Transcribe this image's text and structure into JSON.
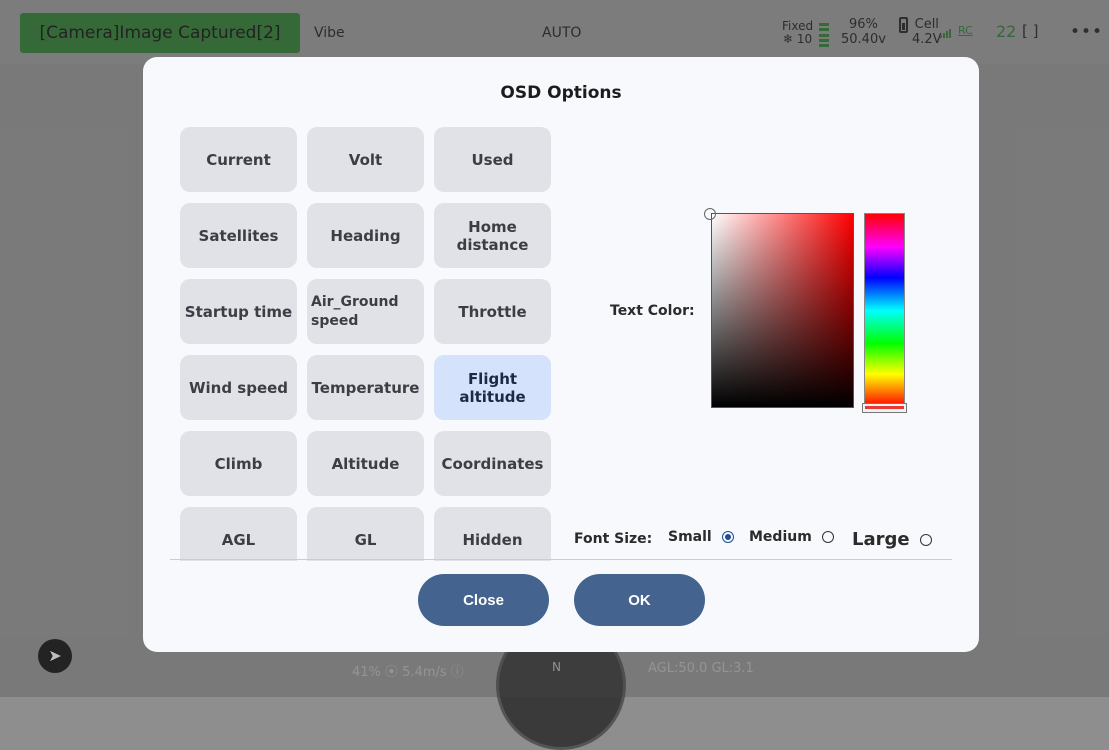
{
  "topbar": {
    "camera_status": "[Camera]Image Captured[2]",
    "vibe": "Vibe",
    "flight_mode": "AUTO",
    "gps_fix": "Fixed",
    "gps_sats": "❄ 10",
    "battery_percent": "96%",
    "battery_voltage": "50.40v",
    "cell_label": "Cell",
    "cell_voltage": "4.2V",
    "rc_label": "RC",
    "rc_value": "22",
    "brackets": "[ ]",
    "more": "•••"
  },
  "background": {
    "bottom_left_stat": "41% ⦿ 5.4m/s ⓘ",
    "bottom_right_stat": "AGL:50.0 GL:3.1",
    "compass_north": "N"
  },
  "dialog": {
    "title": "OSD Options",
    "options": [
      {
        "label": "Current",
        "selected": false
      },
      {
        "label": "Volt",
        "selected": false
      },
      {
        "label": "Used",
        "selected": false
      },
      {
        "label": "Satellites",
        "selected": false
      },
      {
        "label": "Heading",
        "selected": false
      },
      {
        "label": "Home distance",
        "selected": false
      },
      {
        "label": "Startup time",
        "selected": false
      },
      {
        "label": "Air_Ground speed",
        "selected": false
      },
      {
        "label": "Throttle",
        "selected": false
      },
      {
        "label": "Wind speed",
        "selected": false
      },
      {
        "label": "Temperature",
        "selected": false
      },
      {
        "label": "Flight altitude",
        "selected": true
      },
      {
        "label": "Climb",
        "selected": false
      },
      {
        "label": "Altitude",
        "selected": false
      },
      {
        "label": "Coordinates",
        "selected": false
      },
      {
        "label": "AGL",
        "selected": false
      },
      {
        "label": "GL",
        "selected": false
      },
      {
        "label": "Hidden",
        "selected": false
      }
    ],
    "text_color_label": "Text Color:",
    "selected_color": "#ff0000",
    "font_size": {
      "label": "Font Size:",
      "small": "Small",
      "medium": "Medium",
      "large": "Large",
      "selected": "Small"
    },
    "close_label": "Close",
    "ok_label": "OK"
  },
  "colors": {
    "button_primary": "#44648f",
    "selected_option": "#d4e2fb",
    "option_bg": "#e0e2e7",
    "status_green": "#2e7d32"
  }
}
